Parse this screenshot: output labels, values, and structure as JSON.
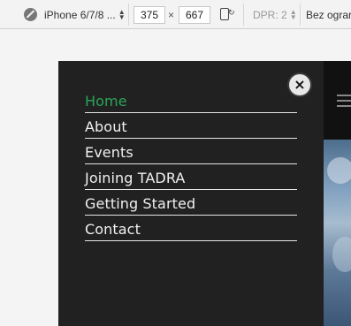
{
  "devtools": {
    "device": "iPhone 6/7/8 ...",
    "width": "375",
    "height": "667",
    "times": "×",
    "dpr": "DPR: 2",
    "throttle": "Bez ograr"
  },
  "menu": {
    "close_label": "×",
    "items": [
      {
        "label": "Home",
        "active": true
      },
      {
        "label": "About"
      },
      {
        "label": "Events"
      },
      {
        "label": "Joining TADRA"
      },
      {
        "label": "Getting Started"
      },
      {
        "label": "Contact"
      }
    ]
  },
  "colors": {
    "panel": "#212121",
    "active": "#2aa55a",
    "text": "#f0f0f0"
  }
}
